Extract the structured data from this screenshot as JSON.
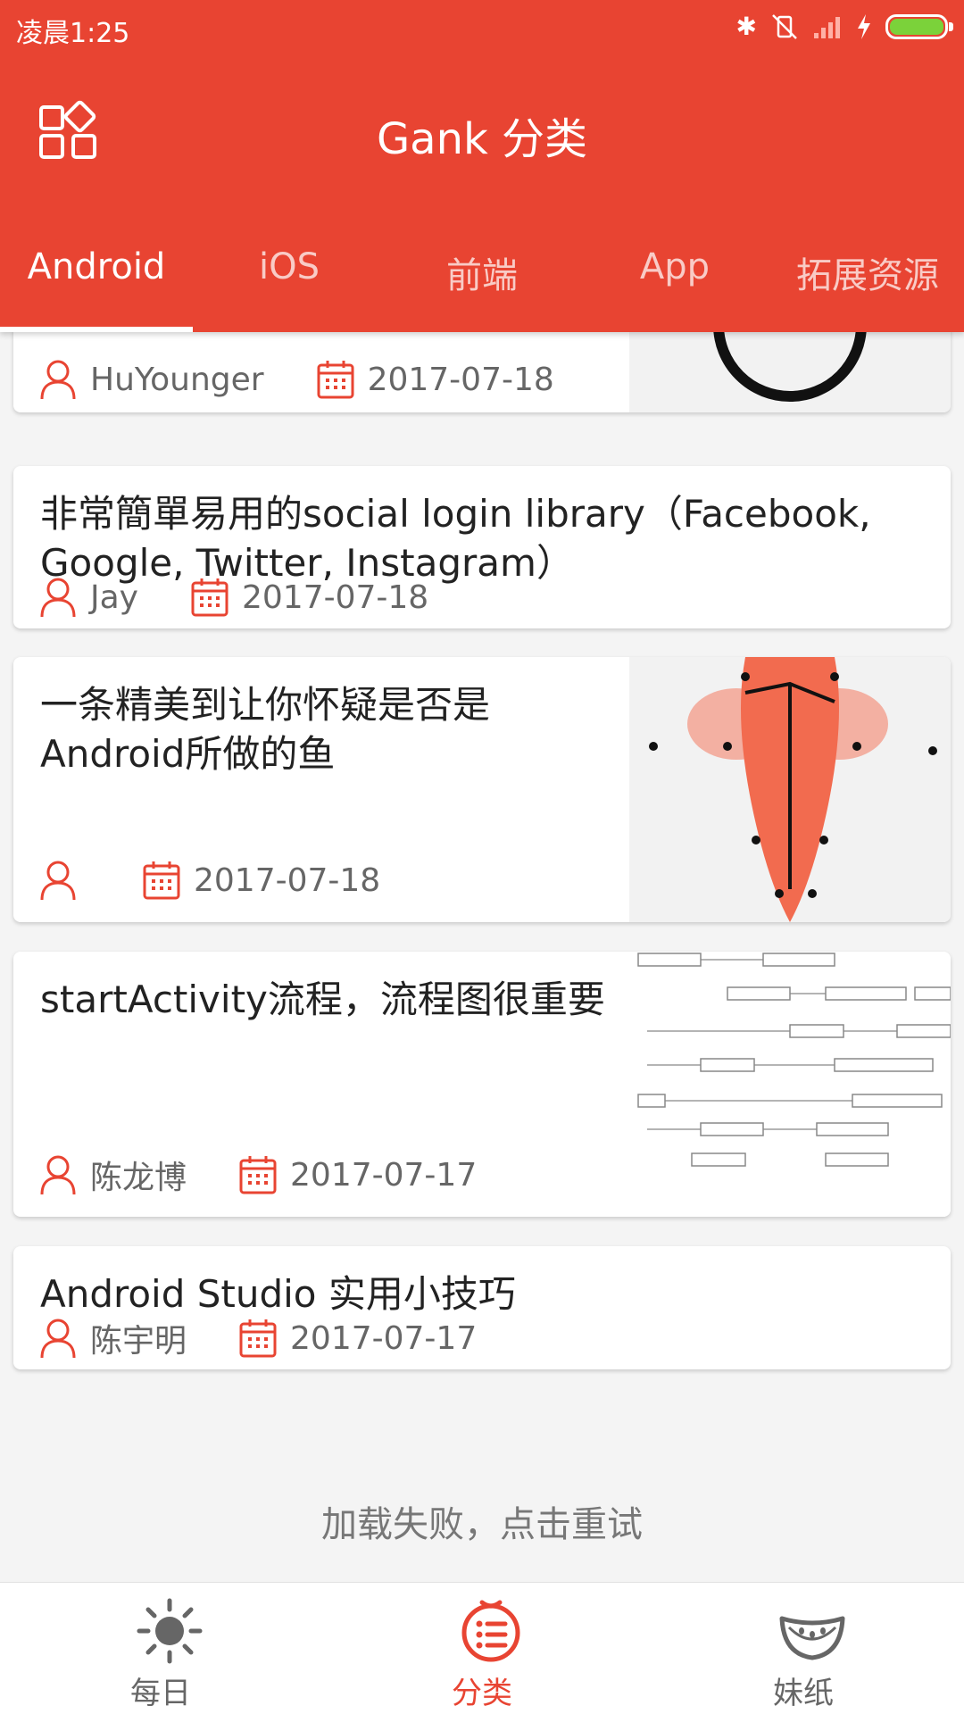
{
  "status_bar": {
    "time": "凌晨1:25"
  },
  "toolbar": {
    "title": "Gank 分类"
  },
  "tabs": [
    {
      "label": "Android"
    },
    {
      "label": "iOS"
    },
    {
      "label": "前端"
    },
    {
      "label": "App"
    },
    {
      "label": "拓展资源"
    }
  ],
  "active_tab": 0,
  "articles": [
    {
      "title": "",
      "author": "HuYounger",
      "date": "2017-07-18",
      "has_image": true
    },
    {
      "title": "非常簡單易用的social login library（Facebook, Google, Twitter, Instagram）",
      "author": "Jay",
      "date": "2017-07-18",
      "has_image": false
    },
    {
      "title": "一条精美到让你怀疑是否是Android所做的鱼",
      "author": "",
      "date": "2017-07-18",
      "has_image": true
    },
    {
      "title": "startActivity流程，流程图很重要",
      "author": "陈龙博",
      "date": "2017-07-17",
      "has_image": true
    },
    {
      "title": "Android Studio 实用小技巧",
      "author": "陈宇明",
      "date": "2017-07-17",
      "has_image": false
    }
  ],
  "load_more": {
    "label": "加载失败，点击重试"
  },
  "bottom_nav": [
    {
      "label": "每日",
      "icon": "sun-icon"
    },
    {
      "label": "分类",
      "icon": "list-icon"
    },
    {
      "label": "妹纸",
      "icon": "watermelon-icon"
    }
  ],
  "active_nav": 1,
  "colors": {
    "primary": "#e84432",
    "battery": "#7bd23a",
    "meta_text": "#666666"
  }
}
